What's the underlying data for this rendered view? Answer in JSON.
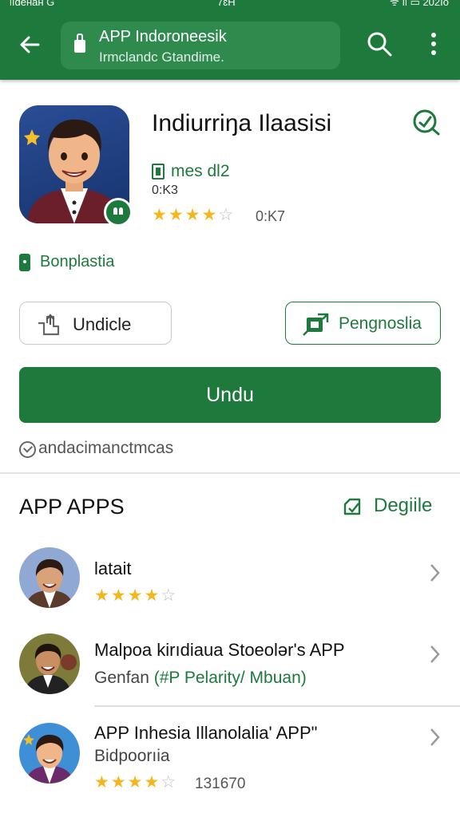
{
  "status": {
    "left": "lıdeнан G",
    "mid": "7ɛH",
    "right": "ᯤ ıl ▭ 202ıo"
  },
  "appbar": {
    "title": "APP Indoroneesik",
    "subtitle": "Irmclandc Gtandime.",
    "back_icon": "arrow-left-icon",
    "search_icon": "search-icon",
    "more_icon": "more-vert-icon"
  },
  "app": {
    "title": "Indiurriŋa Ilaasisi",
    "developer": "mes dl2",
    "size": "0:K3",
    "rating_stars": 4,
    "rating_count": "0:K7",
    "tag": "Bonplastia"
  },
  "actions": {
    "share_label": "Undicle",
    "install_small_label": "Pengnoslia",
    "primary_label": "Undu",
    "note": "andacimanctmcas"
  },
  "section": {
    "title": "APP APPS",
    "link_label": "Degiile"
  },
  "list": [
    {
      "title": "latait",
      "subtitle": "",
      "subtitle_green": "",
      "stars": 4,
      "count": ""
    },
    {
      "title": "Malpoa kirıdiaua Stoeolər's APP",
      "subtitle": "Genfan",
      "subtitle_green": "(#P Pelarity/ Mbuan)",
      "stars": 0,
      "count": ""
    },
    {
      "title": "APP Inhesia     Illanolalia' APP\"",
      "subtitle": "Bidpoorıia",
      "subtitle_green": "",
      "stars": 4,
      "count": "131670"
    }
  ],
  "colors": {
    "brand": "#1d7a3c",
    "star": "#f3b61c"
  }
}
